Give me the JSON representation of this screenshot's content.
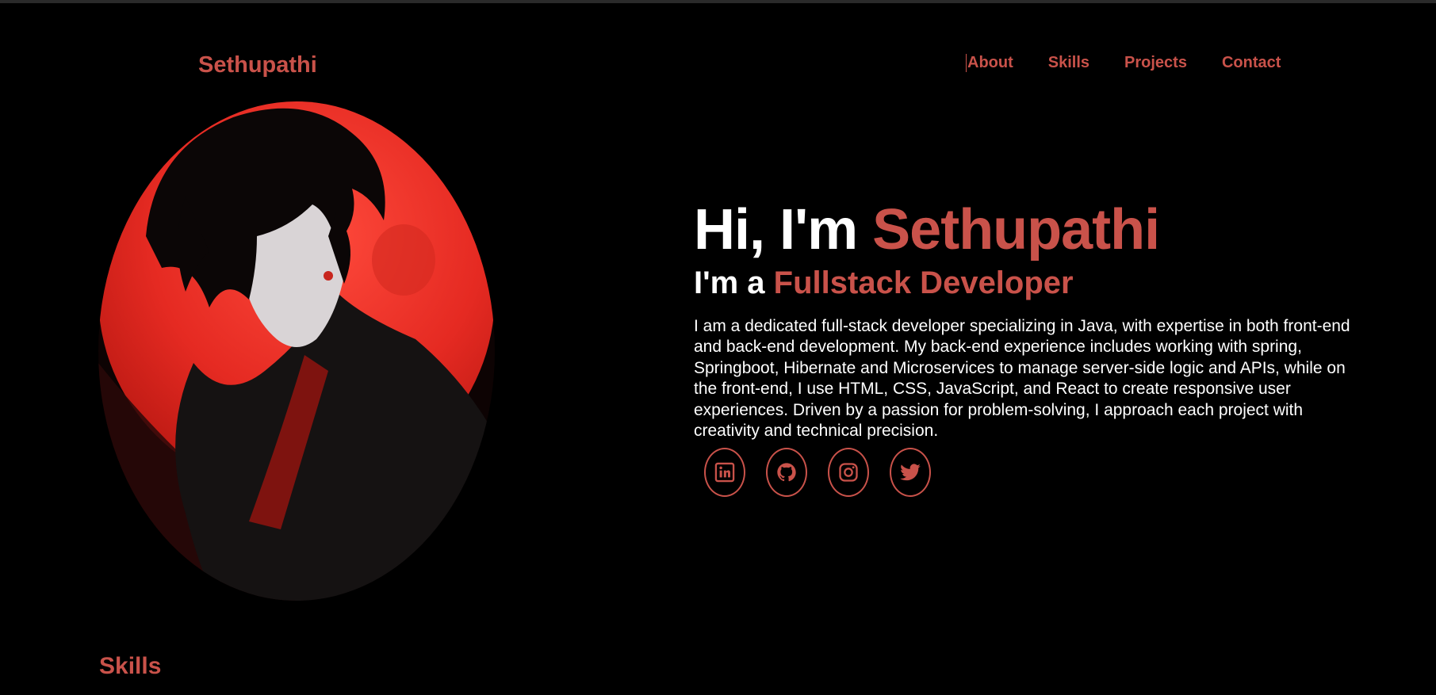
{
  "header": {
    "logo": "Sethupathi",
    "nav": [
      "About",
      "Skills",
      "Projects",
      "Contact"
    ]
  },
  "hero": {
    "greeting": "Hi, I'm ",
    "name": "Sethupathi",
    "role_prefix": "I'm a ",
    "role": "Fullstack Developer",
    "bio": "I am a dedicated full-stack developer specializing in Java, with expertise in both front-end and back-end development. My back-end experience includes working with spring, Springboot, Hibernate and Microservices to manage server-side logic and APIs, while on the front-end, I use HTML, CSS, JavaScript, and React to create responsive user experiences. Driven by a passion for problem-solving, I approach each project with creativity and technical precision."
  },
  "socials": [
    {
      "icon": "linkedin-icon"
    },
    {
      "icon": "github-icon"
    },
    {
      "icon": "instagram-icon"
    },
    {
      "icon": "twitter-icon"
    }
  ],
  "sections": {
    "skills_title": "Skills"
  },
  "colors": {
    "accent": "#c9524a",
    "background": "#000000",
    "text": "#ffffff"
  }
}
